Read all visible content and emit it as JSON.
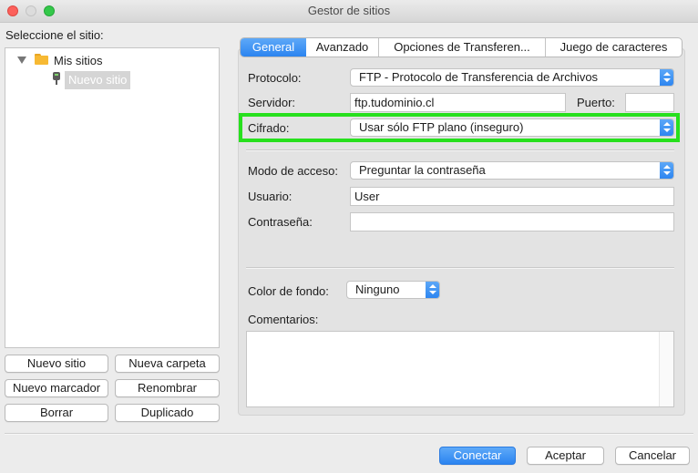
{
  "window": {
    "title": "Gestor de sitios"
  },
  "sidebar": {
    "label": "Seleccione el sitio:",
    "tree": {
      "root": "Mis sitios",
      "children": [
        "Nuevo sitio"
      ],
      "selected": "Nuevo sitio"
    },
    "buttons": {
      "new_site": "Nuevo sitio",
      "new_folder": "Nueva carpeta",
      "new_bookmark": "Nuevo marcador",
      "rename": "Renombrar",
      "delete": "Borrar",
      "duplicate": "Duplicado"
    }
  },
  "tabs": [
    "General",
    "Avanzado",
    "Opciones de Transferen...",
    "Juego de caracteres"
  ],
  "active_tab": "General",
  "form": {
    "protocol": {
      "label": "Protocolo:",
      "value": "FTP - Protocolo de Transferencia de Archivos"
    },
    "server": {
      "label": "Servidor:",
      "value": "ftp.tudominio.cl"
    },
    "port": {
      "label": "Puerto:",
      "value": ""
    },
    "encryption": {
      "label": "Cifrado:",
      "value": "Usar sólo FTP plano (inseguro)"
    },
    "access_mode": {
      "label": "Modo de acceso:",
      "value": "Preguntar la contraseña"
    },
    "user": {
      "label": "Usuario:",
      "value": "User"
    },
    "password": {
      "label": "Contraseña:",
      "value": ""
    },
    "bg_color": {
      "label": "Color de fondo:",
      "value": "Ninguno"
    },
    "comments": {
      "label": "Comentarios:",
      "value": ""
    }
  },
  "footer": {
    "connect": "Conectar",
    "accept": "Aceptar",
    "cancel": "Cancelar"
  },
  "colors": {
    "accent": "#2b84f0",
    "highlight": "#27e01d",
    "folder": "#f7b933"
  }
}
